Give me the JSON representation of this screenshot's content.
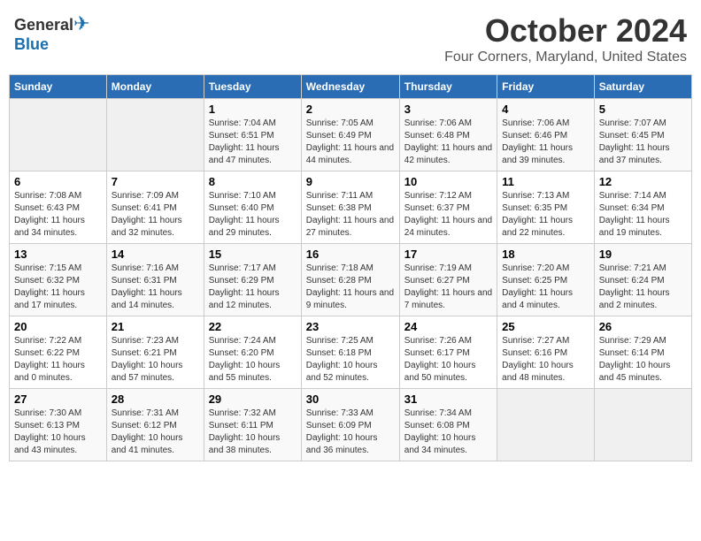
{
  "header": {
    "logo_general": "General",
    "logo_blue": "Blue",
    "month": "October 2024",
    "location": "Four Corners, Maryland, United States"
  },
  "weekdays": [
    "Sunday",
    "Monday",
    "Tuesday",
    "Wednesday",
    "Thursday",
    "Friday",
    "Saturday"
  ],
  "weeks": [
    [
      {
        "day": "",
        "sunrise": "",
        "sunset": "",
        "daylight": ""
      },
      {
        "day": "",
        "sunrise": "",
        "sunset": "",
        "daylight": ""
      },
      {
        "day": "1",
        "sunrise": "Sunrise: 7:04 AM",
        "sunset": "Sunset: 6:51 PM",
        "daylight": "Daylight: 11 hours and 47 minutes."
      },
      {
        "day": "2",
        "sunrise": "Sunrise: 7:05 AM",
        "sunset": "Sunset: 6:49 PM",
        "daylight": "Daylight: 11 hours and 44 minutes."
      },
      {
        "day": "3",
        "sunrise": "Sunrise: 7:06 AM",
        "sunset": "Sunset: 6:48 PM",
        "daylight": "Daylight: 11 hours and 42 minutes."
      },
      {
        "day": "4",
        "sunrise": "Sunrise: 7:06 AM",
        "sunset": "Sunset: 6:46 PM",
        "daylight": "Daylight: 11 hours and 39 minutes."
      },
      {
        "day": "5",
        "sunrise": "Sunrise: 7:07 AM",
        "sunset": "Sunset: 6:45 PM",
        "daylight": "Daylight: 11 hours and 37 minutes."
      }
    ],
    [
      {
        "day": "6",
        "sunrise": "Sunrise: 7:08 AM",
        "sunset": "Sunset: 6:43 PM",
        "daylight": "Daylight: 11 hours and 34 minutes."
      },
      {
        "day": "7",
        "sunrise": "Sunrise: 7:09 AM",
        "sunset": "Sunset: 6:41 PM",
        "daylight": "Daylight: 11 hours and 32 minutes."
      },
      {
        "day": "8",
        "sunrise": "Sunrise: 7:10 AM",
        "sunset": "Sunset: 6:40 PM",
        "daylight": "Daylight: 11 hours and 29 minutes."
      },
      {
        "day": "9",
        "sunrise": "Sunrise: 7:11 AM",
        "sunset": "Sunset: 6:38 PM",
        "daylight": "Daylight: 11 hours and 27 minutes."
      },
      {
        "day": "10",
        "sunrise": "Sunrise: 7:12 AM",
        "sunset": "Sunset: 6:37 PM",
        "daylight": "Daylight: 11 hours and 24 minutes."
      },
      {
        "day": "11",
        "sunrise": "Sunrise: 7:13 AM",
        "sunset": "Sunset: 6:35 PM",
        "daylight": "Daylight: 11 hours and 22 minutes."
      },
      {
        "day": "12",
        "sunrise": "Sunrise: 7:14 AM",
        "sunset": "Sunset: 6:34 PM",
        "daylight": "Daylight: 11 hours and 19 minutes."
      }
    ],
    [
      {
        "day": "13",
        "sunrise": "Sunrise: 7:15 AM",
        "sunset": "Sunset: 6:32 PM",
        "daylight": "Daylight: 11 hours and 17 minutes."
      },
      {
        "day": "14",
        "sunrise": "Sunrise: 7:16 AM",
        "sunset": "Sunset: 6:31 PM",
        "daylight": "Daylight: 11 hours and 14 minutes."
      },
      {
        "day": "15",
        "sunrise": "Sunrise: 7:17 AM",
        "sunset": "Sunset: 6:29 PM",
        "daylight": "Daylight: 11 hours and 12 minutes."
      },
      {
        "day": "16",
        "sunrise": "Sunrise: 7:18 AM",
        "sunset": "Sunset: 6:28 PM",
        "daylight": "Daylight: 11 hours and 9 minutes."
      },
      {
        "day": "17",
        "sunrise": "Sunrise: 7:19 AM",
        "sunset": "Sunset: 6:27 PM",
        "daylight": "Daylight: 11 hours and 7 minutes."
      },
      {
        "day": "18",
        "sunrise": "Sunrise: 7:20 AM",
        "sunset": "Sunset: 6:25 PM",
        "daylight": "Daylight: 11 hours and 4 minutes."
      },
      {
        "day": "19",
        "sunrise": "Sunrise: 7:21 AM",
        "sunset": "Sunset: 6:24 PM",
        "daylight": "Daylight: 11 hours and 2 minutes."
      }
    ],
    [
      {
        "day": "20",
        "sunrise": "Sunrise: 7:22 AM",
        "sunset": "Sunset: 6:22 PM",
        "daylight": "Daylight: 11 hours and 0 minutes."
      },
      {
        "day": "21",
        "sunrise": "Sunrise: 7:23 AM",
        "sunset": "Sunset: 6:21 PM",
        "daylight": "Daylight: 10 hours and 57 minutes."
      },
      {
        "day": "22",
        "sunrise": "Sunrise: 7:24 AM",
        "sunset": "Sunset: 6:20 PM",
        "daylight": "Daylight: 10 hours and 55 minutes."
      },
      {
        "day": "23",
        "sunrise": "Sunrise: 7:25 AM",
        "sunset": "Sunset: 6:18 PM",
        "daylight": "Daylight: 10 hours and 52 minutes."
      },
      {
        "day": "24",
        "sunrise": "Sunrise: 7:26 AM",
        "sunset": "Sunset: 6:17 PM",
        "daylight": "Daylight: 10 hours and 50 minutes."
      },
      {
        "day": "25",
        "sunrise": "Sunrise: 7:27 AM",
        "sunset": "Sunset: 6:16 PM",
        "daylight": "Daylight: 10 hours and 48 minutes."
      },
      {
        "day": "26",
        "sunrise": "Sunrise: 7:29 AM",
        "sunset": "Sunset: 6:14 PM",
        "daylight": "Daylight: 10 hours and 45 minutes."
      }
    ],
    [
      {
        "day": "27",
        "sunrise": "Sunrise: 7:30 AM",
        "sunset": "Sunset: 6:13 PM",
        "daylight": "Daylight: 10 hours and 43 minutes."
      },
      {
        "day": "28",
        "sunrise": "Sunrise: 7:31 AM",
        "sunset": "Sunset: 6:12 PM",
        "daylight": "Daylight: 10 hours and 41 minutes."
      },
      {
        "day": "29",
        "sunrise": "Sunrise: 7:32 AM",
        "sunset": "Sunset: 6:11 PM",
        "daylight": "Daylight: 10 hours and 38 minutes."
      },
      {
        "day": "30",
        "sunrise": "Sunrise: 7:33 AM",
        "sunset": "Sunset: 6:09 PM",
        "daylight": "Daylight: 10 hours and 36 minutes."
      },
      {
        "day": "31",
        "sunrise": "Sunrise: 7:34 AM",
        "sunset": "Sunset: 6:08 PM",
        "daylight": "Daylight: 10 hours and 34 minutes."
      },
      {
        "day": "",
        "sunrise": "",
        "sunset": "",
        "daylight": ""
      },
      {
        "day": "",
        "sunrise": "",
        "sunset": "",
        "daylight": ""
      }
    ]
  ]
}
